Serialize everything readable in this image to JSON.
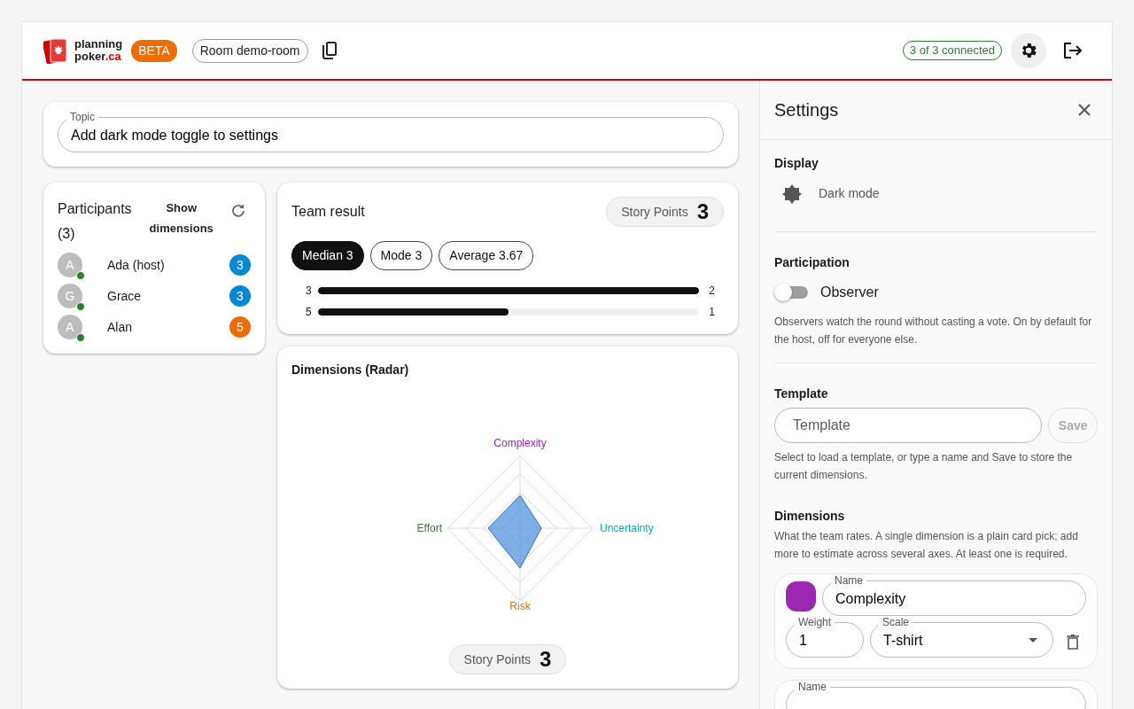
{
  "header": {
    "logo_top": "planning",
    "logo_bottom": "poker",
    "logo_suffix": ".ca",
    "beta": "BETA",
    "room": "Room demo-room",
    "connected": "3 of 3 connected"
  },
  "topic": {
    "label": "Topic",
    "value": "Add dark mode toggle to settings"
  },
  "participants": {
    "title": "Participants",
    "count": "(3)",
    "toggle": "Show dimensions",
    "items": [
      {
        "initial": "A",
        "name": "Ada (host)",
        "online": true,
        "vote": "3",
        "color": "#0288d1"
      },
      {
        "initial": "G",
        "name": "Grace",
        "online": true,
        "vote": "3",
        "color": "#0288d1"
      },
      {
        "initial": "A",
        "name": "Alan",
        "online": true,
        "vote": "5",
        "color": "#ef6c00"
      }
    ]
  },
  "result": {
    "title": "Team result",
    "unit": "Story Points",
    "value": "3",
    "stats": [
      {
        "label": "Median 3",
        "selected": true
      },
      {
        "label": "Mode 3",
        "selected": false
      },
      {
        "label": "Average 3.67",
        "selected": false
      }
    ],
    "distribution": [
      {
        "card": "3",
        "level": 1,
        "count": "2"
      },
      {
        "card": "5",
        "level": 0.5,
        "count": "1"
      }
    ]
  },
  "radar": {
    "title": "Dimensions (Radar)",
    "axes": [
      {
        "label": "Complexity",
        "color": "#9c27b0"
      },
      {
        "label": "Uncertainty",
        "color": "#00acc1"
      },
      {
        "label": "Risk",
        "color": "#ef6c00"
      },
      {
        "label": "Effort",
        "color": "#2e7d32"
      }
    ],
    "unit": "Story Points",
    "value": "3"
  },
  "settings": {
    "title": "Settings",
    "display": {
      "heading": "Display",
      "item": "Dark mode"
    },
    "participation": {
      "heading": "Participation",
      "observer": {
        "label": "Observer",
        "on": false
      },
      "help": "Observers watch the round without casting a vote. On by default for the host, off for everyone else."
    },
    "template": {
      "heading": "Template",
      "placeholder": "Template",
      "save": "Save",
      "save_disabled": true,
      "help": "Select to load a template, or type a name and Save to store the current dimensions."
    },
    "dimensions": {
      "heading": "Dimensions",
      "help": "What the team rates. A single dimension is a plain card pick; add more to estimate across several axes. At least one is required.",
      "items": [
        {
          "color": "#9c27b0",
          "name_label": "Name",
          "name": "Complexity",
          "weight_label": "Weight",
          "weight": "1",
          "scale_label": "Scale",
          "scale": "T-shirt"
        },
        {
          "name_label": "Name"
        }
      ]
    }
  }
}
